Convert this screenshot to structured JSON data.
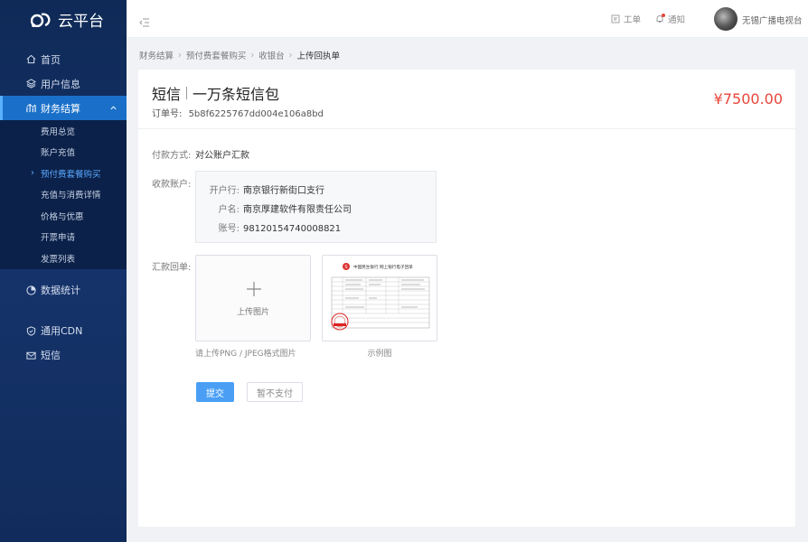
{
  "app": {
    "name": "云平台"
  },
  "sidebar": {
    "items": [
      {
        "label": "首页",
        "icon": "home-icon"
      },
      {
        "label": "用户信息",
        "icon": "layers-icon"
      },
      {
        "label": "财务结算",
        "icon": "finance-icon"
      },
      {
        "label": "数据统计",
        "icon": "pie-chart-icon"
      },
      {
        "label": "通用CDN",
        "icon": "shield-icon"
      },
      {
        "label": "短信",
        "icon": "mail-icon"
      }
    ],
    "finance_sub": [
      {
        "label": "费用总览"
      },
      {
        "label": "账户充值"
      },
      {
        "label": "预付费套餐购买"
      },
      {
        "label": "充值与消费详情"
      },
      {
        "label": "价格与优惠"
      },
      {
        "label": "开票申请"
      },
      {
        "label": "发票列表"
      }
    ]
  },
  "header": {
    "ticket_label": "工单",
    "notify_label": "通知",
    "username": "无锡广播电视台"
  },
  "breadcrumb": [
    "财务结算",
    "预付费套餐购买",
    "收银台",
    "上传回执单"
  ],
  "order": {
    "product_type": "短信",
    "product_name": "一万条短信包",
    "order_label": "订单号:",
    "order_no": "5b8f6225767dd004e106a8bd",
    "price": "¥7500.00"
  },
  "payment": {
    "method_label": "付款方式:",
    "method_value": "对公账户汇款",
    "account_label": "收款账户:",
    "bank_key": "开户行:",
    "bank_val": "南京银行新街口支行",
    "holder_key": "户名:",
    "holder_val": "南京厚建软件有限责任公司",
    "number_key": "账号:",
    "number_val": "98120154740008821",
    "receipt_label": "汇款回单:",
    "upload_text": "上传图片",
    "upload_hint": "请上传PNG / JPEG格式图片",
    "sample_caption": "示例图",
    "sample_title": "中国民生银行 网上银行电子回单"
  },
  "actions": {
    "submit": "提交",
    "skip": "暂不支付"
  },
  "colors": {
    "sidebar_bg": "#12305f",
    "active": "#1a70c9",
    "primary_button": "#4a9ff5",
    "price": "#e8463a"
  }
}
